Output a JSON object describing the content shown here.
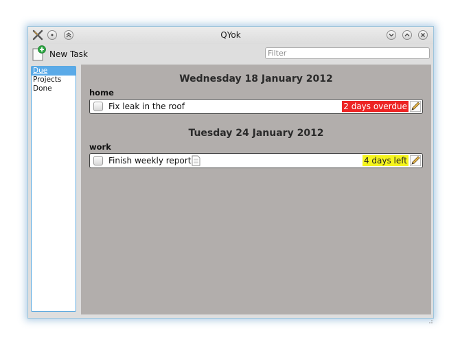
{
  "window": {
    "title": "QYok"
  },
  "toolbar": {
    "new_task_label": "New Task",
    "filter_placeholder": "Filter"
  },
  "sidebar": {
    "items": [
      {
        "label": "Due"
      },
      {
        "label": "Projects"
      },
      {
        "label": "Done"
      }
    ]
  },
  "groups": [
    {
      "date": "Wednesday 18 January 2012",
      "project": "home",
      "tasks": [
        {
          "title": "Fix leak in the roof",
          "status": "2 days overdue",
          "status_type": "overdue"
        }
      ]
    },
    {
      "date": "Tuesday 24 January 2012",
      "project": "work",
      "tasks": [
        {
          "title": "Finish weekly report",
          "status": "4 days left",
          "status_type": "left",
          "has_note": true
        }
      ]
    }
  ],
  "colors": {
    "overdue": "#ec2424",
    "days_left": "#f5f51e",
    "selection": "#5aaae8",
    "main_background": "#b2aeac"
  }
}
